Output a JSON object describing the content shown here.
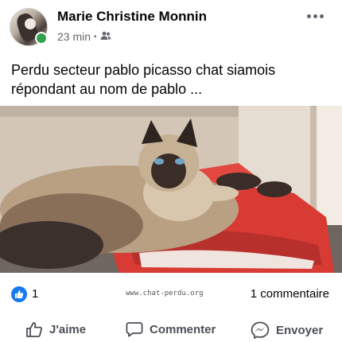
{
  "post": {
    "author": "Marie Christine Monnin",
    "time": "23 min",
    "separator": "•",
    "text": "Perdu secteur pablo picasso chat siamois répondant au nom de pablo ..."
  },
  "stats": {
    "like_count": "1",
    "watermark": "www.chat-perdu.org",
    "comments": "1 commentaire"
  },
  "actions": {
    "like": "J'aime",
    "comment": "Commenter",
    "share": "Envoyer"
  },
  "colors": {
    "like_blue": "#1877f2",
    "online_green": "#31a24c",
    "muted_text": "#65676b"
  }
}
